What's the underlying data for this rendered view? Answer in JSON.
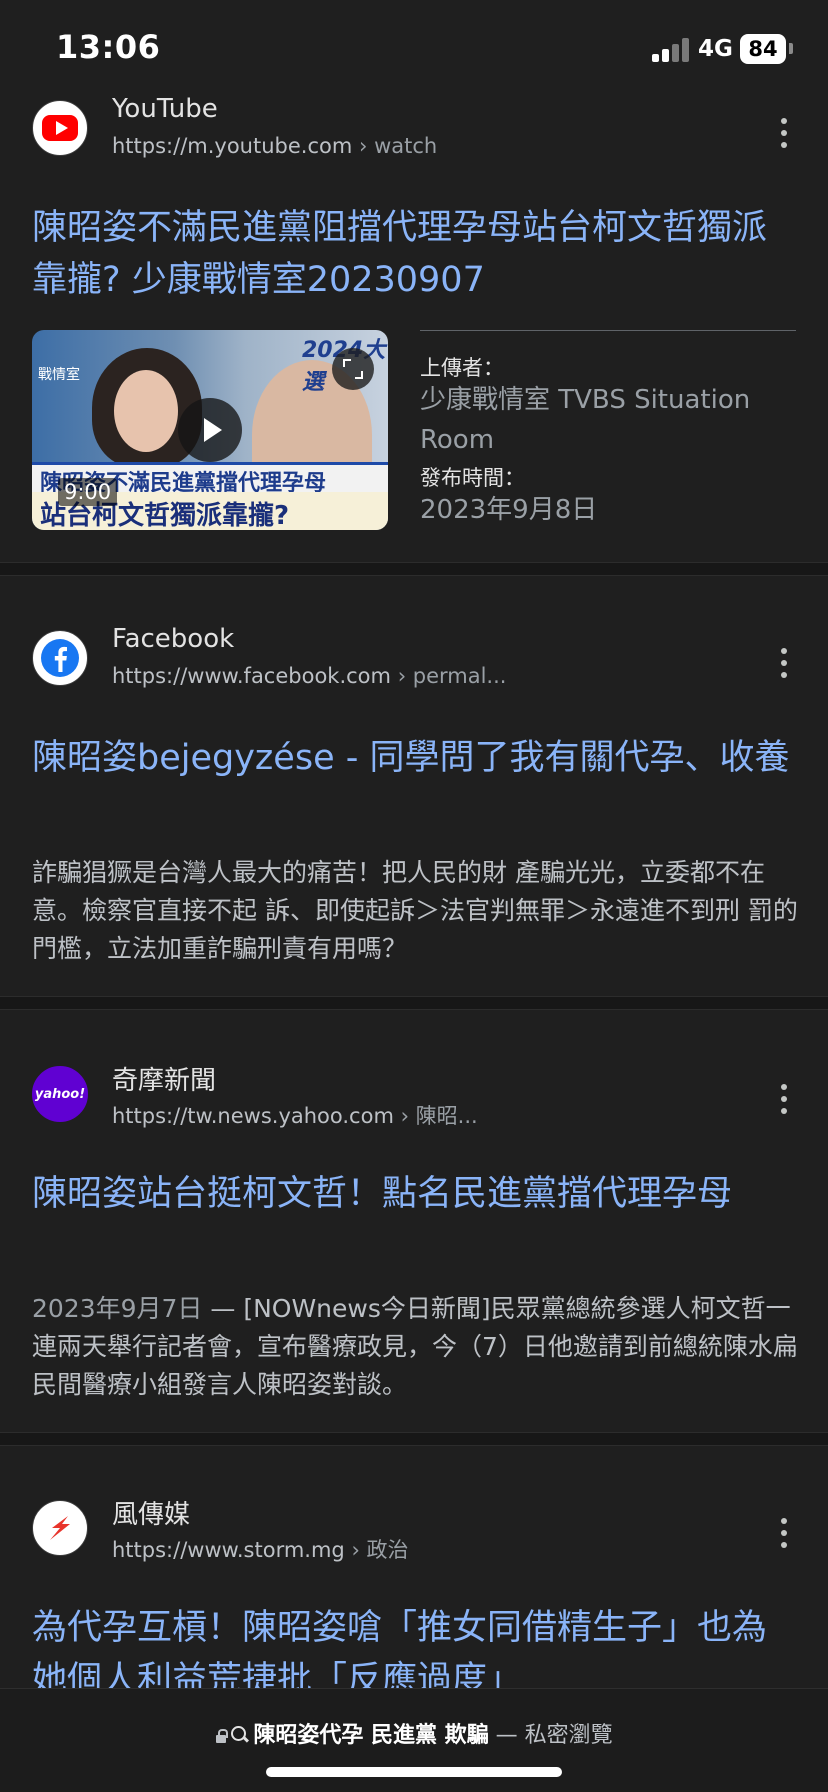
{
  "status_bar": {
    "time": "13:06",
    "network": "4G",
    "battery": "84"
  },
  "results": [
    {
      "site": "YouTube",
      "url": "https://m.youtube.com",
      "crumb": "› watch",
      "title": "陳昭姿不滿民進黨阻擋代理孕母站台柯文哲獨派靠攏? 少康戰情室20230907",
      "video": {
        "duration": "9:00",
        "uploader_label": "上傳者：",
        "uploader": "少康戰情室 TVBS Situation Room",
        "published_label": "發布時間：",
        "published": "2023年9月8日"
      }
    },
    {
      "site": "Facebook",
      "url": "https://www.facebook.com",
      "crumb": "› permal...",
      "title": "陳昭姿bejegyzése - 同學問了我有關代孕、收養",
      "snippet": "詐騙猖獗是台灣人最大的痛苦！把人民的財 產騙光光，立委都不在意。檢察官直接不起 訴、即使起訴＞法官判無罪＞永遠進不到刑 罰的門檻，立法加重詐騙刑責有用嗎？"
    },
    {
      "site": "奇摩新聞",
      "url": "https://tw.news.yahoo.com",
      "crumb": "› 陳昭...",
      "title": "陳昭姿站台挺柯文哲！點名民進黨擋代理孕母",
      "date": "2023年9月7日",
      "snippet": " — [NOWnews今日新聞]民眾黨總統參選人柯文哲一連兩天舉行記者會，宣布醫療政見，今（7）日他邀請到前總統陳水扁民間醫療小組發言人陳昭姿對談。"
    },
    {
      "site": "風傳媒",
      "url": "https://www.storm.mg",
      "crumb": "› 政治",
      "title": "為代孕互槓！陳昭姿嗆「推女同借精生子」也為她個人利益荒捷批「反應過度」"
    }
  ],
  "bottom_bar": {
    "query": "陳昭姿代孕 民進黨 欺騙",
    "mode": " — 私密瀏覽"
  },
  "colors": {
    "background": "#1f1f1f",
    "title_link": "#8ab4f8",
    "snippet": "#bdc1c6",
    "youtube_red": "#ff0000",
    "facebook_blue": "#1877f2",
    "yahoo_purple": "#6001d2",
    "storm_red": "#e8342b"
  }
}
